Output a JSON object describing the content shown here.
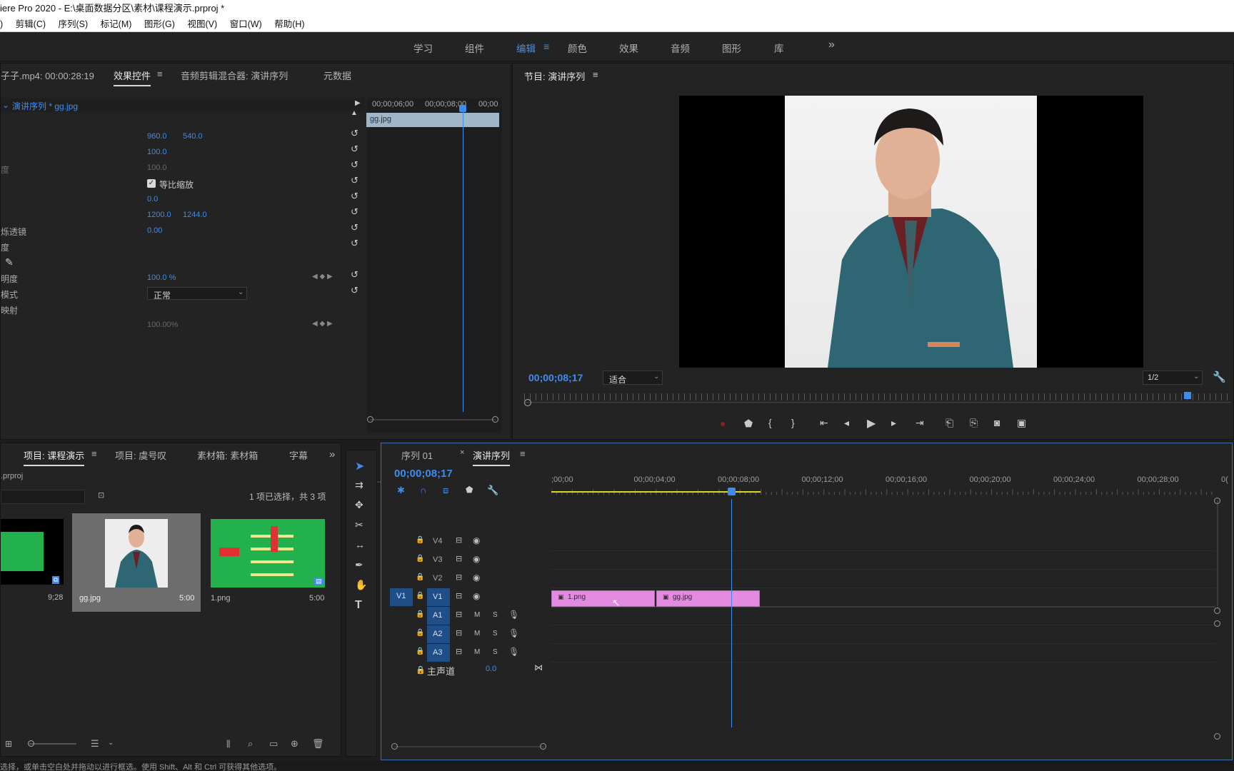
{
  "title": "iere Pro 2020 - E:\\桌面数据分区\\素材\\课程演示.prproj *",
  "menu": [
    ")",
    "剪辑(C)",
    "序列(S)",
    "标记(M)",
    "图形(G)",
    "视图(V)",
    "窗口(W)",
    "帮助(H)"
  ],
  "workspaces": [
    "学习",
    "组件",
    "编辑",
    "颜色",
    "效果",
    "音频",
    "图形",
    "库"
  ],
  "workspace_active": "编辑",
  "workspace_more": "»",
  "effect_panel": {
    "source_label": "子子.mp4: 00:00:28:19",
    "tabs": [
      "效果控件",
      "音频剪辑混合器: 演讲序列",
      "元数据"
    ],
    "clip_path": "演讲序列 * gg.jpg",
    "mini_timecodes": [
      "00;00;06;00",
      "00;00;08;00",
      "00;00"
    ],
    "mini_clip": "gg.jpg",
    "rows": [
      {
        "label": "",
        "v1": "",
        "v2": ""
      },
      {
        "label": "",
        "v1": "960.0",
        "v2": "540.0"
      },
      {
        "label": "",
        "v1": "100.0",
        "v2": ""
      },
      {
        "label": "度",
        "v1": "100.0",
        "v2": "",
        "disabled": true
      },
      {
        "label": "",
        "v1": "等比缩放",
        "v2": "",
        "checkbox": true
      },
      {
        "label": "",
        "v1": "0.0",
        "v2": ""
      },
      {
        "label": "",
        "v1": "1200.0",
        "v2": "1244.0"
      },
      {
        "label": "烁透镜",
        "v1": "0.00",
        "v2": ""
      },
      {
        "label": "度",
        "v1": "",
        "v2": ""
      }
    ],
    "opacity_label": "明度",
    "opacity_value": "100.0 %",
    "blend_label": "模式",
    "blend_value": "正常",
    "remap_label": "映射",
    "speed_value": "100.00%"
  },
  "program": {
    "title": "节目: 演讲序列",
    "timecode": "00;00;08;17",
    "fit": "适合",
    "quality": "1/2"
  },
  "project": {
    "tabs": [
      "项目: 课程演示",
      "项目: 虞号叹",
      "素材箱: 素材箱",
      "字幕"
    ],
    "file": ".prproj",
    "selection": "1 项已选择，共 3 项",
    "items": [
      {
        "name": "",
        "duration": "9;28"
      },
      {
        "name": "gg.jpg",
        "duration": "5:00"
      },
      {
        "name": "1.png",
        "duration": "5:00"
      }
    ]
  },
  "timeline": {
    "tabs": [
      "序列 01",
      "演讲序列"
    ],
    "timecode": "00;00;08;17",
    "ruler": [
      ";00;00",
      "00;00;04;00",
      "00;00;08;00",
      "00;00;12;00",
      "00;00;16;00",
      "00;00;20;00",
      "00;00;24;00",
      "00;00;28;00",
      "0("
    ],
    "video_tracks": [
      "V4",
      "V3",
      "V2",
      "V1"
    ],
    "audio_tracks": [
      "A1",
      "A2",
      "A3"
    ],
    "source_v1": "V1",
    "master_label": "主声道",
    "master_value": "0.0",
    "clips": [
      {
        "name": "1.png",
        "start": 0,
        "end": 5
      },
      {
        "name": "gg.jpg",
        "start": 5,
        "end": 10
      }
    ],
    "playhead_seconds": 8.57,
    "mute": "M",
    "solo": "S"
  },
  "status": "选择，或单击空白处并拖动以进行框选。使用 Shift、Alt 和 Ctrl 可获得其他选项。",
  "colors": {
    "accent": "#3f8cf0",
    "clip": "#e28be0",
    "background": "#232323"
  }
}
